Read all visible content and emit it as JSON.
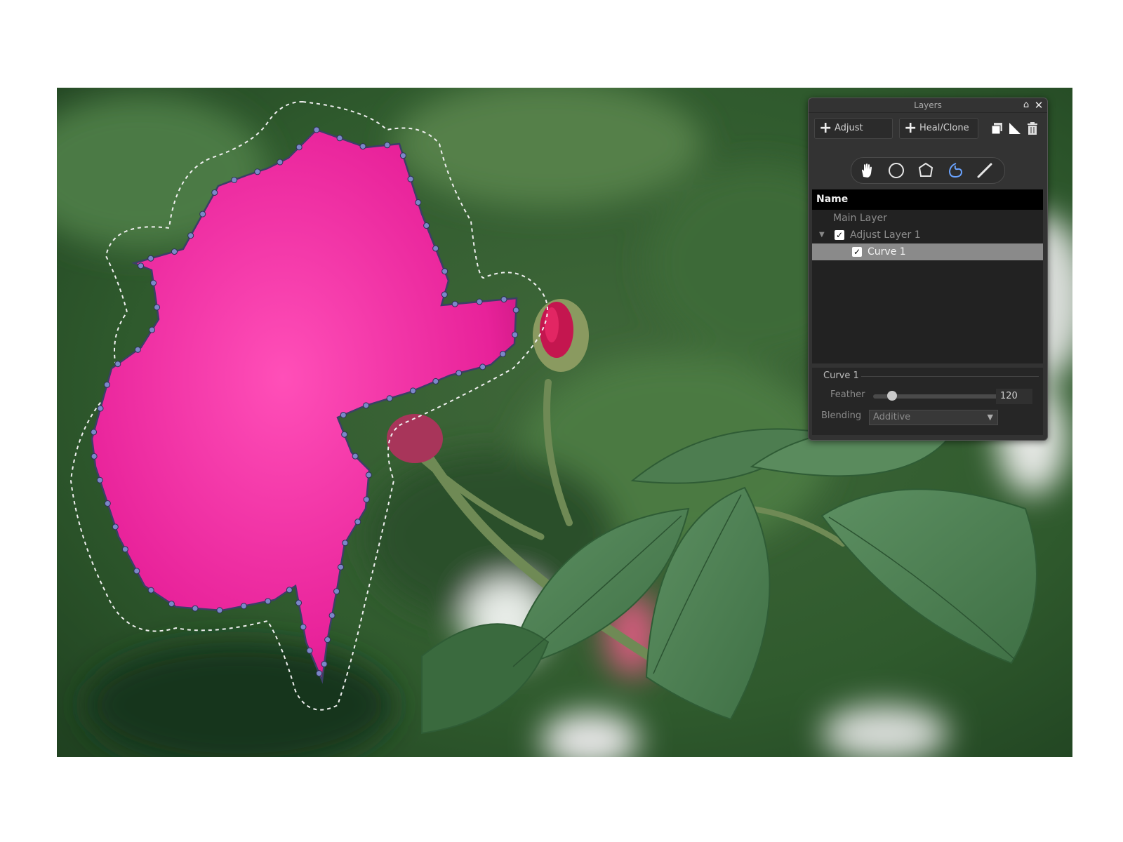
{
  "layers_panel": {
    "title": "Layers",
    "add_adjust_label": "Adjust",
    "add_heal_clone_label": "Heal/Clone",
    "list_header": "Name",
    "layers": [
      {
        "label": "Main Layer",
        "checked": false
      },
      {
        "label": "Adjust Layer 1",
        "checked": true,
        "expanded": true
      },
      {
        "label": "Curve 1",
        "checked": true,
        "selected": true
      }
    ],
    "properties": {
      "title": "Curve 1",
      "feather_label": "Feather",
      "feather_value": "120",
      "feather_level": 0.12,
      "blending_label": "Blending",
      "blending_value": "Additive"
    },
    "mask_tools": [
      "hand-icon",
      "ellipse-icon",
      "polygon-icon",
      "freeform-curve-icon",
      "brush-icon"
    ],
    "header_icons": [
      "home-icon",
      "close-icon"
    ],
    "toolbar_icons": [
      "duplicate-icon",
      "invert-mask-icon",
      "trash-icon"
    ]
  },
  "colors": {
    "panel_bg": "#333333",
    "selection_row": "#8a8a8a",
    "active_tool": "#6aa3ff",
    "mask_node": "#7b87c8",
    "feather_line": "#f0f0f0"
  }
}
